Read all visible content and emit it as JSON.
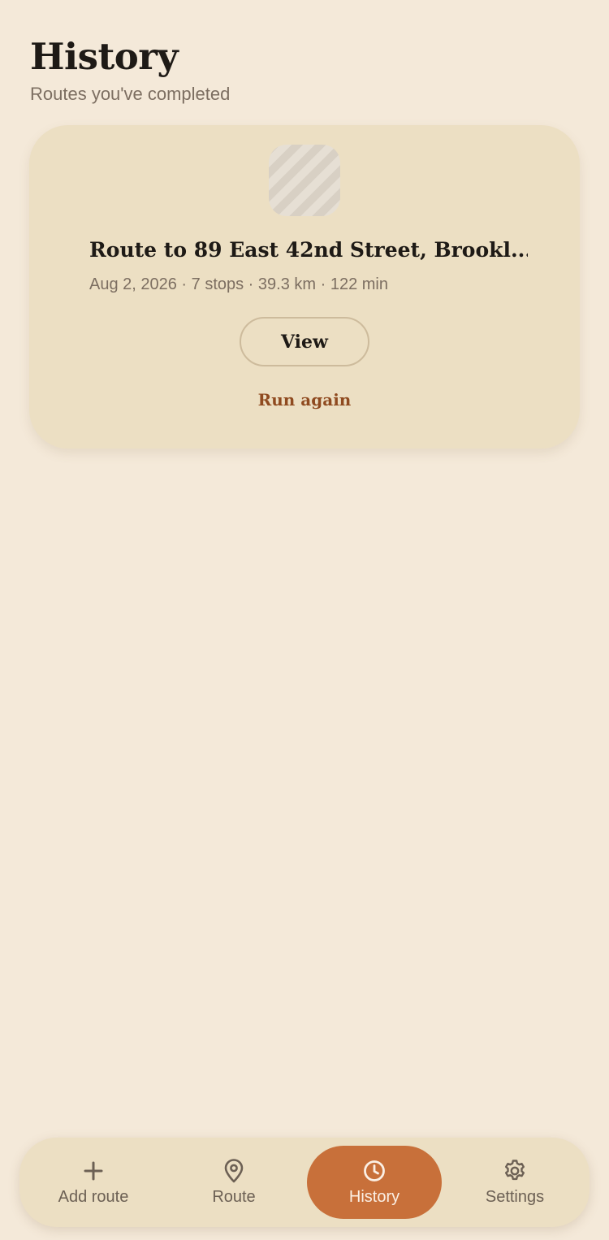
{
  "header": {
    "title": "History",
    "subtitle": "Routes you've completed"
  },
  "history": {
    "items": [
      {
        "title": "Route to 89 East 42nd Street, Brookl...",
        "meta": "Aug 2, 2026 · 7 stops · 39.3 km · 122 min",
        "view_label": "View",
        "run_again_label": "Run again"
      }
    ]
  },
  "nav": {
    "items": [
      {
        "label": "Add route",
        "icon": "plus-icon",
        "active": false
      },
      {
        "label": "Route",
        "icon": "map-pin-icon",
        "active": false
      },
      {
        "label": "History",
        "icon": "clock-icon",
        "active": true
      },
      {
        "label": "Settings",
        "icon": "gear-icon",
        "active": false
      }
    ]
  },
  "colors": {
    "background": "#f4e9d9",
    "card": "#ecdfc3",
    "accent": "#c8703a",
    "link": "#8f4a1f"
  }
}
